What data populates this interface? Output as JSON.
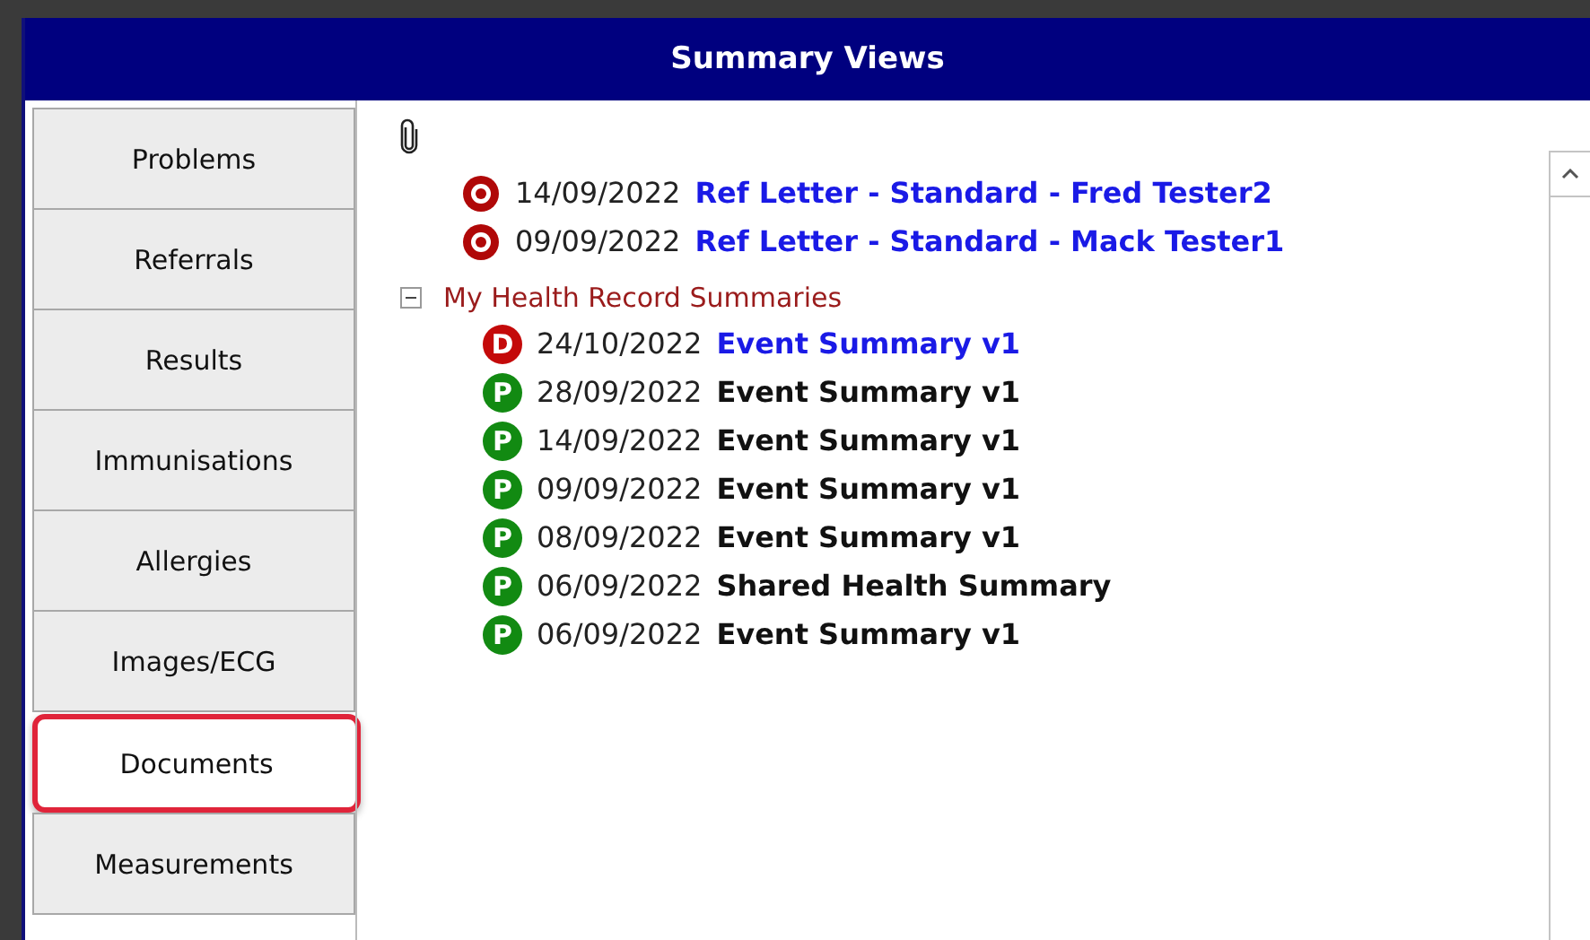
{
  "window": {
    "title": "Summary Views"
  },
  "tabs": [
    {
      "label": "Problems",
      "selected": false
    },
    {
      "label": "Referrals",
      "selected": false
    },
    {
      "label": "Results",
      "selected": false
    },
    {
      "label": "Immunisations",
      "selected": false
    },
    {
      "label": "Allergies",
      "selected": false
    },
    {
      "label": "Images/ECG",
      "selected": false
    },
    {
      "label": "Documents",
      "selected": true
    },
    {
      "label": "Measurements",
      "selected": false
    }
  ],
  "attachments": [
    {
      "kind": "target",
      "date": "14/09/2022",
      "title": "Ref Letter - Standard - Fred Tester2",
      "emphasized": true
    },
    {
      "kind": "target",
      "date": "09/09/2022",
      "title": "Ref Letter - Standard - Mack Tester1",
      "emphasized": true
    }
  ],
  "group": {
    "label": "My Health Record Summaries",
    "expanded": true,
    "items": [
      {
        "kind": "badge",
        "letter": "D",
        "color": "#c40a0a",
        "date": "24/10/2022",
        "title": "Event Summary v1",
        "emphasized": true
      },
      {
        "kind": "badge",
        "letter": "P",
        "color": "#128a12",
        "date": "28/09/2022",
        "title": "Event Summary v1",
        "emphasized": false
      },
      {
        "kind": "badge",
        "letter": "P",
        "color": "#128a12",
        "date": "14/09/2022",
        "title": "Event Summary v1",
        "emphasized": false
      },
      {
        "kind": "badge",
        "letter": "P",
        "color": "#128a12",
        "date": "09/09/2022",
        "title": "Event Summary v1",
        "emphasized": false
      },
      {
        "kind": "badge",
        "letter": "P",
        "color": "#128a12",
        "date": "08/09/2022",
        "title": "Event Summary v1",
        "emphasized": false
      },
      {
        "kind": "badge",
        "letter": "P",
        "color": "#128a12",
        "date": "06/09/2022",
        "title": "Shared Health Summary",
        "emphasized": false
      },
      {
        "kind": "badge",
        "letter": "P",
        "color": "#128a12",
        "date": "06/09/2022",
        "title": "Event Summary v1",
        "emphasized": false
      }
    ]
  }
}
